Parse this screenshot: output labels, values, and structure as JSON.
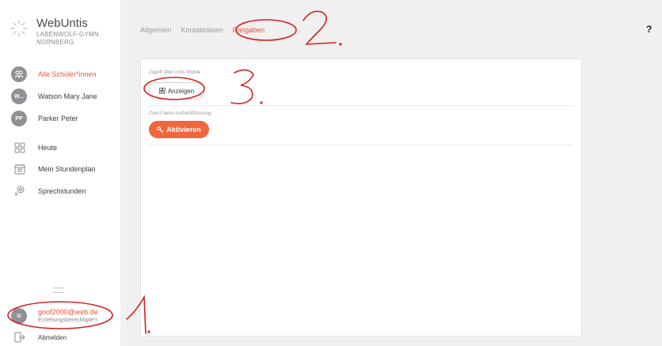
{
  "app": {
    "title": "WebUntis",
    "school_line1": "LABENWOLF-GYMN.",
    "school_line2": "NÜRNBERG"
  },
  "sidebar": {
    "persons": [
      {
        "initials": "",
        "label": "Alle Schüler*innen"
      },
      {
        "initials": "W...",
        "label": "Watson Mary Jane"
      },
      {
        "initials": "PP",
        "label": "Parker Peter"
      }
    ],
    "nav": [
      {
        "icon": "grid-icon",
        "label": "Heute"
      },
      {
        "icon": "calendar-icon",
        "label": "Mein Stundenplan"
      },
      {
        "icon": "consultation-icon",
        "label": "Sprechstunden"
      }
    ],
    "account": {
      "initials": "G",
      "email": "goof2000@web.de",
      "role": "Erziehungsberechtigte*r"
    },
    "logout_label": "Abmelden"
  },
  "tabs": [
    "Allgemein",
    "Kontaktdaten",
    "Freigaben"
  ],
  "help_label": "?",
  "content": {
    "mobile_access_label": "Zugriff über Untis Mobile",
    "show_button": "Anzeigen",
    "two_factor_label": "Zwei-Faktor-Authentifizierung",
    "activate_button": "Aktivieren"
  },
  "annotations": {
    "one": "1",
    "two": "2",
    "three": "3"
  },
  "colors": {
    "accent": "#e8543b",
    "primary_button": "#f0673d",
    "avatar": "#8f9196",
    "annotation": "#d42020"
  }
}
